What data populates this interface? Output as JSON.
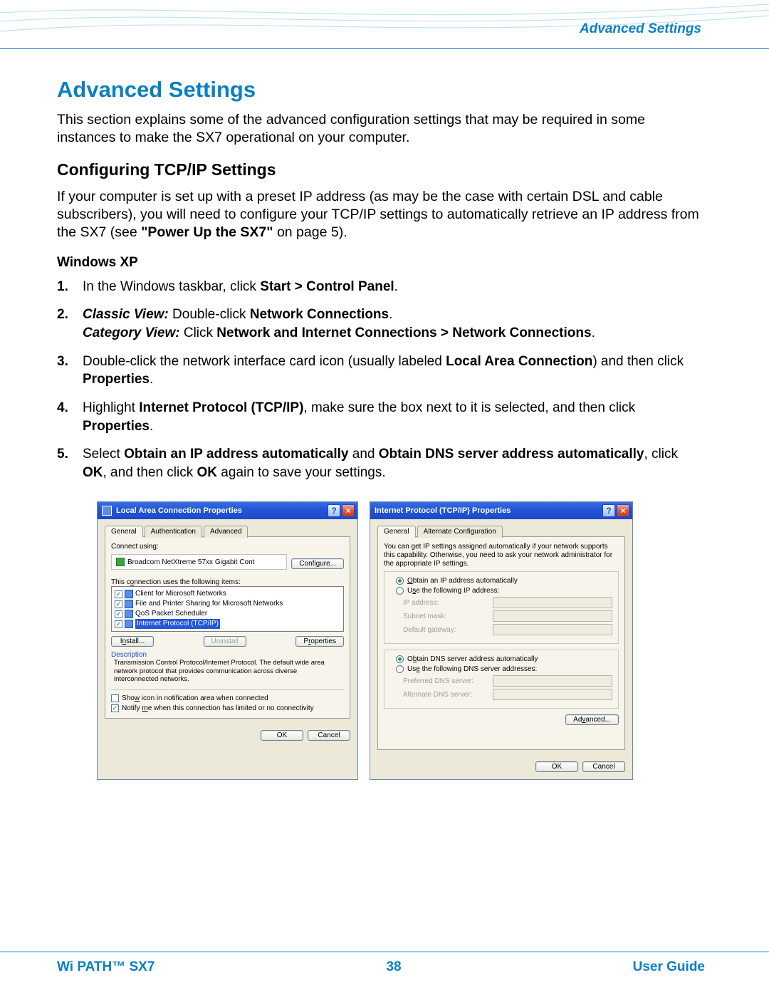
{
  "header": {
    "label": "Advanced Settings"
  },
  "title": "Advanced Settings",
  "intro": "This section explains some of the advanced configuration settings that may be required in some instances to make the SX7 operational on your computer.",
  "section": {
    "heading": "Configuring TCP/IP Settings",
    "intro_pre": "If your computer is set up with a preset IP address (as may be the case with certain DSL and cable subscribers), you will need to configure your TCP/IP settings to automatically retrieve an IP address from the SX7 (see ",
    "intro_ref": "\"Power Up the SX7\"",
    "intro_post": " on page 5)."
  },
  "os_heading": "Windows XP",
  "steps": {
    "s1": {
      "num": "1.",
      "a": "In the Windows taskbar, click ",
      "b": "Start > Control Panel",
      "c": "."
    },
    "s2": {
      "num": "2.",
      "cv_label": "Classic View:",
      "cv_text_a": " Double-click ",
      "cv_bold": "Network Connections",
      "cv_text_b": ".",
      "catv_label": "Category View:",
      "catv_text_a": " Click ",
      "catv_bold": "Network and Internet Connections > Network Connections",
      "catv_text_b": "."
    },
    "s3": {
      "num": "3.",
      "a": "Double-click the network interface card icon (usually labeled ",
      "b": "Local Area Connection",
      "c": ") and then click ",
      "d": "Properties",
      "e": "."
    },
    "s4": {
      "num": "4.",
      "a": "Highlight ",
      "b": "Internet Protocol (TCP/IP)",
      "c": ", make sure the box next to it is selected, and then click ",
      "d": "Properties",
      "e": "."
    },
    "s5": {
      "num": "5.",
      "a": "Select ",
      "b": "Obtain an IP address automatically",
      "c": " and ",
      "d": "Obtain DNS server address automatically",
      "e": ", click ",
      "f": "OK",
      "g": ", and then click ",
      "h": "OK",
      "i": " again to save your settings."
    }
  },
  "dlg1": {
    "title": "Local Area Connection Properties",
    "tabs": [
      "General",
      "Authentication",
      "Advanced"
    ],
    "connect_using_label": "Connect using:",
    "adapter": "Broadcom NetXtreme 57xx Gigabit Cont",
    "configure_btn": "Configure...",
    "items_label": "This connection uses the following items:",
    "items": [
      "Client for Microsoft Networks",
      "File and Printer Sharing for Microsoft Networks",
      "QoS Packet Scheduler",
      "Internet Protocol (TCP/IP)"
    ],
    "install_btn": "Install...",
    "uninstall_btn": "Uninstall",
    "properties_btn": "Properties",
    "desc_hdr": "Description",
    "desc_body": "Transmission Control Protocol/Internet Protocol. The default wide area network protocol that provides communication across diverse interconnected networks.",
    "chk1": "Show icon in notification area when connected",
    "chk2": "Notify me when this connection has limited or no connectivity",
    "ok": "OK",
    "cancel": "Cancel"
  },
  "dlg2": {
    "title": "Internet Protocol (TCP/IP) Properties",
    "tabs": [
      "General",
      "Alternate Configuration"
    ],
    "info": "You can get IP settings assigned automatically if your network supports this capability. Otherwise, you need to ask your network administrator for the appropriate IP settings.",
    "r1": "Obtain an IP address automatically",
    "r2": "Use the following IP address:",
    "f_ip": "IP address:",
    "f_mask": "Subnet mask:",
    "f_gw": "Default gateway:",
    "r3": "Obtain DNS server address automatically",
    "r4": "Use the following DNS server addresses:",
    "f_pdns": "Preferred DNS server:",
    "f_adns": "Alternate DNS server:",
    "advanced_btn": "Advanced...",
    "ok": "OK",
    "cancel": "Cancel"
  },
  "footer": {
    "product": "Wi PATH™ SX7",
    "page": "38",
    "guide": "User Guide"
  }
}
